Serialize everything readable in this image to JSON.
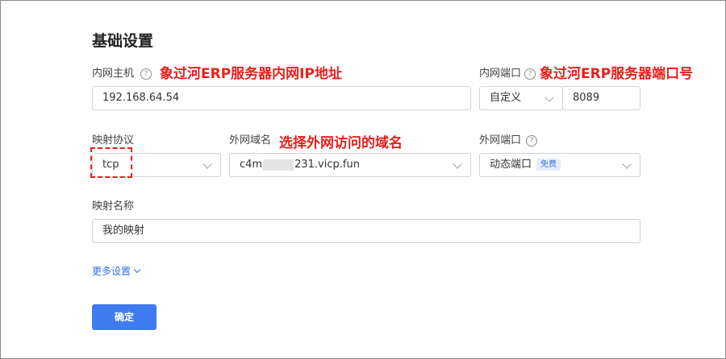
{
  "section_title": "基础设置",
  "internal_host": {
    "label": "内网主机",
    "value": "192.168.64.54",
    "annotation": "象过河ERP服务器内网IP地址"
  },
  "internal_port": {
    "label": "内网端口",
    "mode_value": "自定义",
    "port_value": "8089",
    "annotation": "象过河ERP服务器端口号"
  },
  "protocol": {
    "label": "映射协议",
    "value": "tcp"
  },
  "external_domain": {
    "label": "外网域名",
    "value_prefix": "c4m",
    "value_suffix": "231.vicp.fun",
    "annotation": "选择外网访问的域名"
  },
  "external_port": {
    "label": "外网端口",
    "value": "动态端口",
    "badge": "免费"
  },
  "mapping_name": {
    "label": "映射名称",
    "value": "我的映射"
  },
  "more_settings": "更多设置",
  "confirm_button": "确定",
  "colors": {
    "accent": "#3e7bf0",
    "annotation": "#e8201c"
  },
  "icons": {
    "help": "question-circle-icon",
    "dropdown": "chevron-down-icon"
  }
}
